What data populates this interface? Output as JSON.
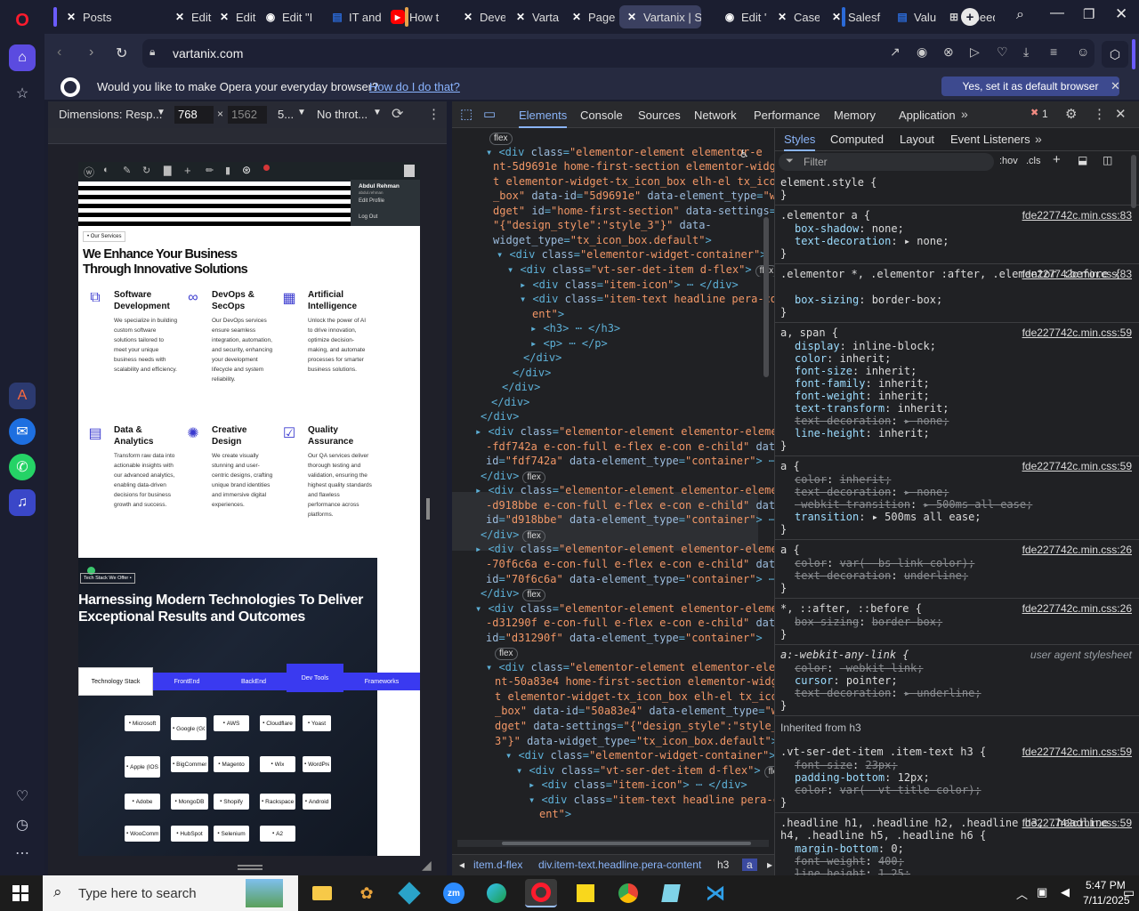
{
  "tabs": [
    {
      "label": "Posts",
      "icon": "vartanix-icon"
    },
    {
      "label": "Edit C",
      "icon": "vartanix-icon"
    },
    {
      "label": "Edit C",
      "icon": "vartanix-icon"
    },
    {
      "label": "Edit \"I",
      "icon": "github-icon"
    },
    {
      "label": "IT and",
      "icon": "document-icon"
    },
    {
      "label": "How t",
      "icon": "youtube-icon"
    },
    {
      "label": "Devel",
      "icon": "vartanix-icon"
    },
    {
      "label": "Vartar",
      "icon": "vartanix-icon"
    },
    {
      "label": "Pages",
      "icon": "vartanix-icon"
    },
    {
      "label": "Vartanix | Sc",
      "icon": "vartanix-icon"
    },
    {
      "label": "Edit \"(",
      "icon": "github-icon"
    },
    {
      "label": "Case s",
      "icon": "vartanix-icon"
    },
    {
      "label": "Salesf",
      "icon": "vartanix-icon"
    },
    {
      "label": "Value",
      "icon": "document-icon"
    },
    {
      "label": "Speed",
      "icon": "grid-icon"
    }
  ],
  "url": "vartanix.com",
  "banner": {
    "question": "Would you like to make Opera your everyday browser?",
    "link": "How do I do that?",
    "button": "Yes, set it as default browser"
  },
  "device": {
    "dimensions": "Dimensions: Resp...",
    "width": "768",
    "height": "1562",
    "zoom": "5...",
    "throttle": "No throt..."
  },
  "devtools": {
    "tabs": [
      "Elements",
      "Console",
      "Sources",
      "Network",
      "Performance",
      "Memory",
      "Application"
    ],
    "error_count": "1",
    "style_tabs": [
      "Styles",
      "Computed",
      "Layout",
      "Event Listeners"
    ],
    "filter": "Filter",
    "hov": ":hov",
    "cls": ".cls"
  },
  "elements_lines": [
    [
      {
        "c": "pill",
        "t": "flex"
      }
    ],
    [
      {
        "c": "tag",
        "t": "▾ <div "
      },
      {
        "c": "an",
        "t": "class"
      },
      {
        "c": "tag",
        "t": "="
      },
      {
        "c": "av",
        "t": "\"elementor-element elementor-e"
      }
    ],
    [
      {
        "c": "av",
        "t": "nt-5d9691e home-first-section elementor-widge"
      }
    ],
    [
      {
        "c": "av",
        "t": "t elementor-widget-tx_icon_box elh-el tx_icon"
      }
    ],
    [
      {
        "c": "av",
        "t": "_box\""
      },
      {
        "c": "an",
        "t": " data-id"
      },
      {
        "c": "tag",
        "t": "="
      },
      {
        "c": "av",
        "t": "\"5d9691e\""
      },
      {
        "c": "an",
        "t": " data-element_type"
      },
      {
        "c": "tag",
        "t": "="
      },
      {
        "c": "av",
        "t": "\"wi"
      }
    ],
    [
      {
        "c": "av",
        "t": "dget\""
      },
      {
        "c": "an",
        "t": " id"
      },
      {
        "c": "tag",
        "t": "="
      },
      {
        "c": "av",
        "t": "\"home-first-section\""
      },
      {
        "c": "an",
        "t": " data-settings"
      },
      {
        "c": "tag",
        "t": "="
      }
    ],
    [
      {
        "c": "av",
        "t": "\"{\"design_style\":\"style_3\"}\""
      },
      {
        "c": "an",
        "t": " data-"
      }
    ],
    [
      {
        "c": "an",
        "t": "widget_type"
      },
      {
        "c": "tag",
        "t": "="
      },
      {
        "c": "av",
        "t": "\"tx_icon_box.default\""
      },
      {
        "c": "tag",
        "t": ">"
      }
    ],
    [
      {
        "c": "tag",
        "t": "▾ <div "
      },
      {
        "c": "an",
        "t": "class"
      },
      {
        "c": "tag",
        "t": "="
      },
      {
        "c": "av",
        "t": "\"elementor-widget-container\""
      },
      {
        "c": "tag",
        "t": ">"
      }
    ],
    [
      {
        "c": "tag",
        "t": "▾ <div "
      },
      {
        "c": "an",
        "t": "class"
      },
      {
        "c": "tag",
        "t": "="
      },
      {
        "c": "av",
        "t": "\"vt-ser-det-item d-flex\""
      },
      {
        "c": "tag",
        "t": ">"
      },
      {
        "c": "pill",
        "t": "flex"
      }
    ],
    [
      {
        "c": "tag",
        "t": "▸ <div "
      },
      {
        "c": "an",
        "t": "class"
      },
      {
        "c": "tag",
        "t": "="
      },
      {
        "c": "av",
        "t": "\"item-icon\""
      },
      {
        "c": "tag",
        "t": "> ⋯ </div>"
      }
    ],
    [
      {
        "c": "tag",
        "t": "▾ <div "
      },
      {
        "c": "an",
        "t": "class"
      },
      {
        "c": "tag",
        "t": "="
      },
      {
        "c": "av",
        "t": "\"item-text headline pera-cont"
      }
    ],
    [
      {
        "c": "av",
        "t": "ent\""
      },
      {
        "c": "tag",
        "t": ">"
      }
    ],
    [
      {
        "c": "tag",
        "t": "▸ <h3> ⋯ </h3>"
      }
    ],
    [
      {
        "c": "tag",
        "t": "▸ <p> ⋯ </p>"
      }
    ],
    [
      {
        "c": "tag",
        "t": "</div>"
      }
    ],
    [
      {
        "c": "tag",
        "t": "</div>"
      }
    ],
    [
      {
        "c": "tag",
        "t": "</div>"
      }
    ],
    [
      {
        "c": "tag",
        "t": "</div>"
      }
    ],
    [
      {
        "c": "tag",
        "t": "</div>"
      }
    ],
    [
      {
        "c": "tag",
        "t": "▸ <div "
      },
      {
        "c": "an",
        "t": "class"
      },
      {
        "c": "tag",
        "t": "="
      },
      {
        "c": "av",
        "t": "\"elementor-element elementor-element"
      }
    ],
    [
      {
        "c": "av",
        "t": "-fdf742a e-con-full e-flex e-con e-child\""
      },
      {
        "c": "an",
        "t": " data-"
      }
    ],
    [
      {
        "c": "an",
        "t": "id"
      },
      {
        "c": "tag",
        "t": "="
      },
      {
        "c": "av",
        "t": "\"fdf742a\""
      },
      {
        "c": "an",
        "t": " data-element_type"
      },
      {
        "c": "tag",
        "t": "="
      },
      {
        "c": "av",
        "t": "\"container\""
      },
      {
        "c": "tag",
        "t": "> ⋯"
      }
    ],
    [
      {
        "c": "tag",
        "t": "</div>"
      },
      {
        "c": "pill",
        "t": "flex"
      }
    ],
    [
      {
        "c": "tag",
        "t": "▸ <div "
      },
      {
        "c": "an",
        "t": "class"
      },
      {
        "c": "tag",
        "t": "="
      },
      {
        "c": "av",
        "t": "\"elementor-element elementor-element"
      }
    ],
    [
      {
        "c": "av",
        "t": "-d918bbe e-con-full e-flex e-con e-child\""
      },
      {
        "c": "an",
        "t": " data-"
      }
    ],
    [
      {
        "c": "an",
        "t": "id"
      },
      {
        "c": "tag",
        "t": "="
      },
      {
        "c": "av",
        "t": "\"d918bbe\""
      },
      {
        "c": "an",
        "t": " data-element_type"
      },
      {
        "c": "tag",
        "t": "="
      },
      {
        "c": "av",
        "t": "\"container\""
      },
      {
        "c": "tag",
        "t": "> ⋯"
      }
    ],
    [
      {
        "c": "tag",
        "t": "</div>"
      },
      {
        "c": "pill",
        "t": "flex"
      }
    ],
    [
      {
        "c": "tag",
        "t": "▸ <div "
      },
      {
        "c": "an",
        "t": "class"
      },
      {
        "c": "tag",
        "t": "="
      },
      {
        "c": "av",
        "t": "\"elementor-element elementor-element"
      }
    ],
    [
      {
        "c": "av",
        "t": "-70f6c6a e-con-full e-flex e-con e-child\""
      },
      {
        "c": "an",
        "t": " data-"
      }
    ],
    [
      {
        "c": "an",
        "t": "id"
      },
      {
        "c": "tag",
        "t": "="
      },
      {
        "c": "av",
        "t": "\"70f6c6a\""
      },
      {
        "c": "an",
        "t": " data-element_type"
      },
      {
        "c": "tag",
        "t": "="
      },
      {
        "c": "av",
        "t": "\"container\""
      },
      {
        "c": "tag",
        "t": "> ⋯"
      }
    ],
    [
      {
        "c": "tag",
        "t": "</div>"
      },
      {
        "c": "pill",
        "t": "flex"
      }
    ],
    [
      {
        "c": "tag",
        "t": "▾ <div "
      },
      {
        "c": "an",
        "t": "class"
      },
      {
        "c": "tag",
        "t": "="
      },
      {
        "c": "av",
        "t": "\"elementor-element elementor-element"
      }
    ],
    [
      {
        "c": "av",
        "t": "-d31290f e-con-full e-flex e-con e-child\""
      },
      {
        "c": "an",
        "t": " data-"
      }
    ],
    [
      {
        "c": "an",
        "t": "id"
      },
      {
        "c": "tag",
        "t": "="
      },
      {
        "c": "av",
        "t": "\"d31290f\""
      },
      {
        "c": "an",
        "t": " data-element_type"
      },
      {
        "c": "tag",
        "t": "="
      },
      {
        "c": "av",
        "t": "\"container\""
      },
      {
        "c": "tag",
        "t": ">"
      }
    ],
    [
      {
        "c": "pill",
        "t": "flex"
      }
    ],
    [
      {
        "c": "tag",
        "t": "▾ <div "
      },
      {
        "c": "an",
        "t": "class"
      },
      {
        "c": "tag",
        "t": "="
      },
      {
        "c": "av",
        "t": "\"elementor-element elementor-eleme"
      }
    ],
    [
      {
        "c": "av",
        "t": "nt-50a83e4 home-first-section elementor-widge"
      }
    ],
    [
      {
        "c": "av",
        "t": "t elementor-widget-tx_icon_box elh-el tx_icon"
      }
    ],
    [
      {
        "c": "av",
        "t": "_box\""
      },
      {
        "c": "an",
        "t": " data-id"
      },
      {
        "c": "tag",
        "t": "="
      },
      {
        "c": "av",
        "t": "\"50a83e4\""
      },
      {
        "c": "an",
        "t": " data-element_type"
      },
      {
        "c": "tag",
        "t": "="
      },
      {
        "c": "av",
        "t": "\"wi"
      }
    ],
    [
      {
        "c": "av",
        "t": "dget\""
      },
      {
        "c": "an",
        "t": " data-settings"
      },
      {
        "c": "tag",
        "t": "="
      },
      {
        "c": "av",
        "t": "\"{\"design_style\":\"style_"
      }
    ],
    [
      {
        "c": "av",
        "t": "3\"}\""
      },
      {
        "c": "an",
        "t": " data-widget_type"
      },
      {
        "c": "tag",
        "t": "="
      },
      {
        "c": "av",
        "t": "\"tx_icon_box.default\""
      },
      {
        "c": "tag",
        "t": ">"
      }
    ],
    [
      {
        "c": "tag",
        "t": "▾ <div "
      },
      {
        "c": "an",
        "t": "class"
      },
      {
        "c": "tag",
        "t": "="
      },
      {
        "c": "av",
        "t": "\"elementor-widget-container\""
      },
      {
        "c": "tag",
        "t": ">"
      }
    ],
    [
      {
        "c": "tag",
        "t": "▾ <div "
      },
      {
        "c": "an",
        "t": "class"
      },
      {
        "c": "tag",
        "t": "="
      },
      {
        "c": "av",
        "t": "\"vt-ser-det-item d-flex\""
      },
      {
        "c": "tag",
        "t": ">"
      },
      {
        "c": "pill",
        "t": "flex"
      }
    ],
    [
      {
        "c": "tag",
        "t": "▸ <div "
      },
      {
        "c": "an",
        "t": "class"
      },
      {
        "c": "tag",
        "t": "="
      },
      {
        "c": "av",
        "t": "\"item-icon\""
      },
      {
        "c": "tag",
        "t": "> ⋯ </div>"
      }
    ],
    [
      {
        "c": "tag",
        "t": "▾ <div "
      },
      {
        "c": "an",
        "t": "class"
      },
      {
        "c": "tag",
        "t": "="
      },
      {
        "c": "av",
        "t": "\"item-text headline pera-cont"
      }
    ],
    [
      {
        "c": "av",
        "t": "ent\""
      },
      {
        "c": "tag",
        "t": ">"
      }
    ]
  ],
  "breadcrumbs": [
    "◂",
    "item.d-flex",
    "div.item-text.headline.pera-content",
    "h3",
    "a",
    "▸"
  ],
  "style_rules": [
    {
      "sel": "element.style {",
      "src": "",
      "props": [],
      "close": "}"
    },
    {
      "sel": ".elementor a {",
      "src": "fde227742c.min.css:83",
      "props": [
        [
          "box-shadow",
          "none",
          false
        ],
        [
          "text-decoration",
          "▸ none",
          false
        ]
      ],
      "close": "}"
    },
    {
      "sel": ".elementor *, .elementor :after, .elementor :before {",
      "src": "fde227742c.min.css:83",
      "props": [
        [
          "box-sizing",
          "border-box",
          false
        ]
      ],
      "close": "}"
    },
    {
      "sel": "a, span {",
      "src": "fde227742c.min.css:59",
      "props": [
        [
          "display",
          "inline-block",
          false
        ],
        [
          "color",
          "inherit",
          false
        ],
        [
          "font-size",
          "inherit",
          false
        ],
        [
          "font-family",
          "inherit",
          false
        ],
        [
          "font-weight",
          "inherit",
          false
        ],
        [
          "text-transform",
          "inherit",
          false
        ],
        [
          "text-decoration",
          "▸ none",
          true
        ],
        [
          "line-height",
          "inherit",
          false
        ]
      ],
      "close": "}"
    },
    {
      "sel": "a {",
      "src": "fde227742c.min.css:59",
      "props": [
        [
          "color",
          "inherit",
          true
        ],
        [
          "text-decoration",
          "▸ none",
          true
        ],
        [
          "-webkit-transition",
          "▸ 500ms all ease",
          true
        ],
        [
          "transition",
          "▸ 500ms all ease",
          false
        ]
      ],
      "close": "}"
    },
    {
      "sel": "a {",
      "src": "fde227742c.min.css:26",
      "props": [
        [
          "color",
          "var(--bs-link-color)",
          true
        ],
        [
          "text-decoration",
          "underline",
          true
        ]
      ],
      "close": "}"
    },
    {
      "sel": "*, ::after, ::before {",
      "src": "fde227742c.min.css:26",
      "props": [
        [
          "box-sizing",
          "border-box",
          true
        ]
      ],
      "close": "}"
    },
    {
      "sel": "a:-webkit-any-link {",
      "src": "user agent stylesheet",
      "props": [
        [
          "color",
          "-webkit-link",
          true
        ],
        [
          "cursor",
          "pointer",
          false
        ],
        [
          "text-decoration",
          "▸ underline",
          true
        ]
      ],
      "close": "}"
    },
    {
      "sel": "Inherited from h3",
      "src": "",
      "props": [],
      "close": ""
    },
    {
      "sel": ".vt-ser-det-item .item-text h3 {",
      "src": "fde227742c.min.css:59",
      "props": [
        [
          "font-size",
          "23px",
          true
        ],
        [
          "padding-bottom",
          "12px",
          false
        ],
        [
          "color",
          "var(--vt-title-color)",
          true
        ]
      ],
      "close": "}"
    },
    {
      "sel": ".headline h1, .headline h2, .headline h3, .headline h4, .headline h5, .headline h6 {",
      "src": "fde227742c.min.css:59",
      "props": [
        [
          "margin-bottom",
          "0",
          false
        ],
        [
          "font-weight",
          "400",
          true
        ],
        [
          "line-height",
          "1.25",
          true
        ]
      ],
      "close": ""
    }
  ],
  "site": {
    "admin_user": "Abdul Rehman",
    "admin_sub": "abdul.rehman",
    "edit_profile": "Edit Profile",
    "logout": "Log Out",
    "badge": "• Our Services",
    "heading": "We Enhance Your Business Through Innovative Solutions",
    "services": [
      {
        "title": "Software Development",
        "desc": "We specialize in building custom software solutions tailored to meet your unique business needs with scalability and efficiency.",
        "icon": "code-icon"
      },
      {
        "title": "DevOps & SecOps",
        "desc": "Our DevOps services ensure seamless integration, automation, and security, enhancing your development lifecycle and system reliability.",
        "icon": "infinity-icon"
      },
      {
        "title": "Artificial Intelligence",
        "desc": "Unlock the power of AI to drive innovation, optimize decision-making, and automate processes for smarter business solutions.",
        "icon": "ai-chip-icon"
      },
      {
        "title": "Data & Analytics",
        "desc": "Transform raw data into actionable insights with our advanced analytics, enabling data-driven decisions for business growth and success.",
        "icon": "analytics-icon"
      },
      {
        "title": "Creative Design",
        "desc": "We create visually stunning and user-centric designs, crafting unique brand identities and immersive digital experiences.",
        "icon": "bulb-icon"
      },
      {
        "title": "Quality Assurance",
        "desc": "Our QA services deliver thorough testing and validation, ensuring the highest quality standards and flawless performance across platforms.",
        "icon": "qa-icon"
      }
    ],
    "tech_badge": "Tech Stack We Offer •",
    "tech_heading": "Harnessing Modern Technologies To Deliver Exceptional Results and Outcomes",
    "stack_tabs": [
      "Technology Stack",
      "FrontEnd",
      "BackEnd",
      "Dev Tools",
      "Frameworks"
    ],
    "chips": [
      [
        "Microsoft",
        "Google (GCP)",
        "AWS",
        "Cloudflare",
        "Yoast"
      ],
      [
        "Apple (IOS)",
        "BigCommerce",
        "Magento",
        "Wix",
        "WordPress"
      ],
      [
        "Adobe",
        "MongoDB",
        "Shopify",
        "Rackspace",
        "Android"
      ],
      [
        "WooCommerce",
        "HubSpot",
        "Selenium",
        "A2"
      ]
    ]
  },
  "taskbar": {
    "search": "Type here to search",
    "time": "5:47 PM",
    "date": "7/11/2025"
  }
}
